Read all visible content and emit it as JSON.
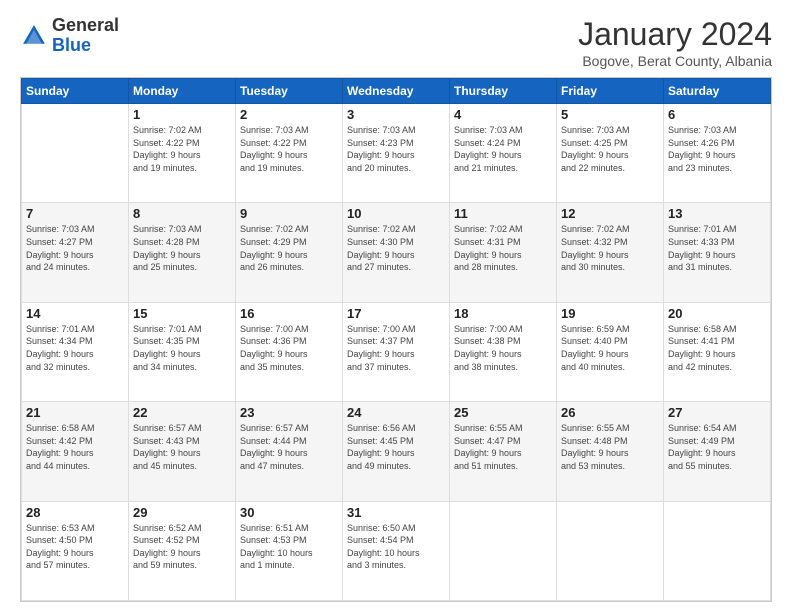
{
  "header": {
    "logo": {
      "general": "General",
      "blue": "Blue"
    },
    "title": "January 2024",
    "subtitle": "Bogove, Berat County, Albania"
  },
  "days_of_week": [
    "Sunday",
    "Monday",
    "Tuesday",
    "Wednesday",
    "Thursday",
    "Friday",
    "Saturday"
  ],
  "weeks": [
    [
      {
        "day": "",
        "info": ""
      },
      {
        "day": "1",
        "info": "Sunrise: 7:02 AM\nSunset: 4:22 PM\nDaylight: 9 hours\nand 19 minutes."
      },
      {
        "day": "2",
        "info": "Sunrise: 7:03 AM\nSunset: 4:22 PM\nDaylight: 9 hours\nand 19 minutes."
      },
      {
        "day": "3",
        "info": "Sunrise: 7:03 AM\nSunset: 4:23 PM\nDaylight: 9 hours\nand 20 minutes."
      },
      {
        "day": "4",
        "info": "Sunrise: 7:03 AM\nSunset: 4:24 PM\nDaylight: 9 hours\nand 21 minutes."
      },
      {
        "day": "5",
        "info": "Sunrise: 7:03 AM\nSunset: 4:25 PM\nDaylight: 9 hours\nand 22 minutes."
      },
      {
        "day": "6",
        "info": "Sunrise: 7:03 AM\nSunset: 4:26 PM\nDaylight: 9 hours\nand 23 minutes."
      }
    ],
    [
      {
        "day": "7",
        "info": "Sunrise: 7:03 AM\nSunset: 4:27 PM\nDaylight: 9 hours\nand 24 minutes."
      },
      {
        "day": "8",
        "info": "Sunrise: 7:03 AM\nSunset: 4:28 PM\nDaylight: 9 hours\nand 25 minutes."
      },
      {
        "day": "9",
        "info": "Sunrise: 7:02 AM\nSunset: 4:29 PM\nDaylight: 9 hours\nand 26 minutes."
      },
      {
        "day": "10",
        "info": "Sunrise: 7:02 AM\nSunset: 4:30 PM\nDaylight: 9 hours\nand 27 minutes."
      },
      {
        "day": "11",
        "info": "Sunrise: 7:02 AM\nSunset: 4:31 PM\nDaylight: 9 hours\nand 28 minutes."
      },
      {
        "day": "12",
        "info": "Sunrise: 7:02 AM\nSunset: 4:32 PM\nDaylight: 9 hours\nand 30 minutes."
      },
      {
        "day": "13",
        "info": "Sunrise: 7:01 AM\nSunset: 4:33 PM\nDaylight: 9 hours\nand 31 minutes."
      }
    ],
    [
      {
        "day": "14",
        "info": "Sunrise: 7:01 AM\nSunset: 4:34 PM\nDaylight: 9 hours\nand 32 minutes."
      },
      {
        "day": "15",
        "info": "Sunrise: 7:01 AM\nSunset: 4:35 PM\nDaylight: 9 hours\nand 34 minutes."
      },
      {
        "day": "16",
        "info": "Sunrise: 7:00 AM\nSunset: 4:36 PM\nDaylight: 9 hours\nand 35 minutes."
      },
      {
        "day": "17",
        "info": "Sunrise: 7:00 AM\nSunset: 4:37 PM\nDaylight: 9 hours\nand 37 minutes."
      },
      {
        "day": "18",
        "info": "Sunrise: 7:00 AM\nSunset: 4:38 PM\nDaylight: 9 hours\nand 38 minutes."
      },
      {
        "day": "19",
        "info": "Sunrise: 6:59 AM\nSunset: 4:40 PM\nDaylight: 9 hours\nand 40 minutes."
      },
      {
        "day": "20",
        "info": "Sunrise: 6:58 AM\nSunset: 4:41 PM\nDaylight: 9 hours\nand 42 minutes."
      }
    ],
    [
      {
        "day": "21",
        "info": "Sunrise: 6:58 AM\nSunset: 4:42 PM\nDaylight: 9 hours\nand 44 minutes."
      },
      {
        "day": "22",
        "info": "Sunrise: 6:57 AM\nSunset: 4:43 PM\nDaylight: 9 hours\nand 45 minutes."
      },
      {
        "day": "23",
        "info": "Sunrise: 6:57 AM\nSunset: 4:44 PM\nDaylight: 9 hours\nand 47 minutes."
      },
      {
        "day": "24",
        "info": "Sunrise: 6:56 AM\nSunset: 4:45 PM\nDaylight: 9 hours\nand 49 minutes."
      },
      {
        "day": "25",
        "info": "Sunrise: 6:55 AM\nSunset: 4:47 PM\nDaylight: 9 hours\nand 51 minutes."
      },
      {
        "day": "26",
        "info": "Sunrise: 6:55 AM\nSunset: 4:48 PM\nDaylight: 9 hours\nand 53 minutes."
      },
      {
        "day": "27",
        "info": "Sunrise: 6:54 AM\nSunset: 4:49 PM\nDaylight: 9 hours\nand 55 minutes."
      }
    ],
    [
      {
        "day": "28",
        "info": "Sunrise: 6:53 AM\nSunset: 4:50 PM\nDaylight: 9 hours\nand 57 minutes."
      },
      {
        "day": "29",
        "info": "Sunrise: 6:52 AM\nSunset: 4:52 PM\nDaylight: 9 hours\nand 59 minutes."
      },
      {
        "day": "30",
        "info": "Sunrise: 6:51 AM\nSunset: 4:53 PM\nDaylight: 10 hours\nand 1 minute."
      },
      {
        "day": "31",
        "info": "Sunrise: 6:50 AM\nSunset: 4:54 PM\nDaylight: 10 hours\nand 3 minutes."
      },
      {
        "day": "",
        "info": ""
      },
      {
        "day": "",
        "info": ""
      },
      {
        "day": "",
        "info": ""
      }
    ]
  ]
}
